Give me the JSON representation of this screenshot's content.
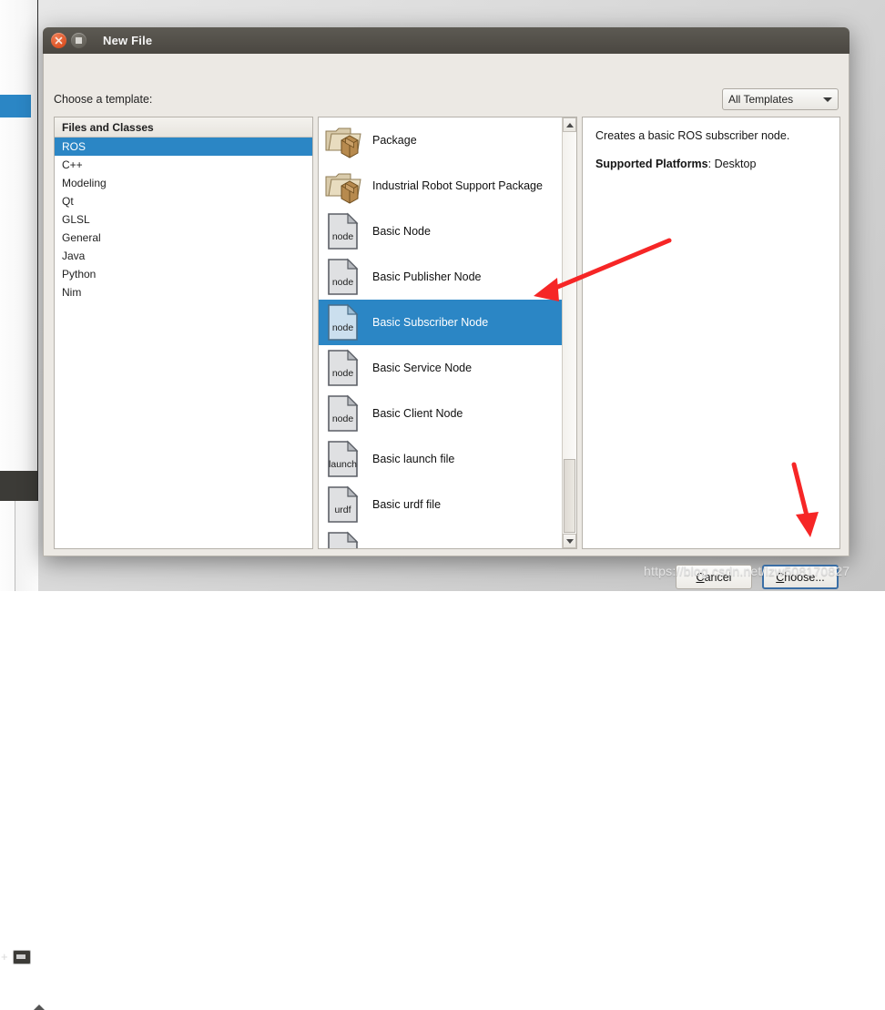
{
  "window": {
    "title": "New File",
    "close_icon": "close-icon",
    "maximize_icon": "maximize-icon"
  },
  "dialog": {
    "prompt": "Choose a template:",
    "filter_combo": {
      "value": "All Templates",
      "arrow_icon": "chevron-down-icon"
    }
  },
  "categories": {
    "header": "Files and Classes",
    "items": [
      {
        "label": "ROS",
        "selected": true
      },
      {
        "label": "C++",
        "selected": false
      },
      {
        "label": "Modeling",
        "selected": false
      },
      {
        "label": "Qt",
        "selected": false
      },
      {
        "label": "GLSL",
        "selected": false
      },
      {
        "label": "General",
        "selected": false
      },
      {
        "label": "Java",
        "selected": false
      },
      {
        "label": "Python",
        "selected": false
      },
      {
        "label": "Nim",
        "selected": false
      }
    ]
  },
  "templates": {
    "items": [
      {
        "label": "Package",
        "icon": "package-folder-icon",
        "icon_text": "",
        "selected": false
      },
      {
        "label": "Industrial Robot Support Package",
        "icon": "package-folder-icon",
        "icon_text": "",
        "selected": false
      },
      {
        "label": "Basic Node",
        "icon": "file-icon",
        "icon_text": "node",
        "selected": false
      },
      {
        "label": "Basic Publisher Node",
        "icon": "file-icon",
        "icon_text": "node",
        "selected": false
      },
      {
        "label": "Basic Subscriber Node",
        "icon": "file-icon",
        "icon_text": "node",
        "selected": true
      },
      {
        "label": "Basic Service Node",
        "icon": "file-icon",
        "icon_text": "node",
        "selected": false
      },
      {
        "label": "Basic Client Node",
        "icon": "file-icon",
        "icon_text": "node",
        "selected": false
      },
      {
        "label": "Basic launch file",
        "icon": "file-icon",
        "icon_text": "launch",
        "selected": false
      },
      {
        "label": "Basic urdf file",
        "icon": "file-icon",
        "icon_text": "urdf",
        "selected": false
      },
      {
        "label": "",
        "icon": "file-icon",
        "icon_text": "",
        "selected": false
      }
    ],
    "scrollbar": {
      "up_icon": "scroll-up-icon",
      "down_icon": "scroll-down-icon"
    }
  },
  "description": {
    "summary": "Creates a basic ROS subscriber node.",
    "platforms_label": "Supported Platforms",
    "platforms_separator": ": ",
    "platforms_value": "Desktop"
  },
  "footer": {
    "cancel": {
      "pre": "",
      "mnemonic": "C",
      "post": "ancel"
    },
    "choose": {
      "pre": "",
      "mnemonic": "C",
      "post": "hoose..."
    }
  },
  "watermark": "https://blog.csdn.net/lzw508170827",
  "colors": {
    "selection_blue": "#2b86c5",
    "titlebar": "#4a4741",
    "dialog_bg": "#ece9e4",
    "annotation_red": "#f62626",
    "focus_border": "#3a6ea5"
  }
}
